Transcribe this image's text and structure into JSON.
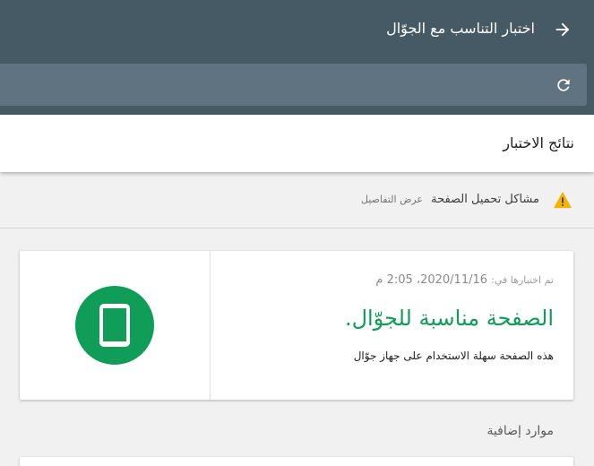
{
  "header": {
    "title": "اختبار التناسب مع الجوّال",
    "back_icon": "arrow-right-icon",
    "url_value": "",
    "refresh_icon": "refresh-icon",
    "background_color": "#455a64",
    "url_bar_color": "#5f7480"
  },
  "results": {
    "title": "نتائج الاختبار"
  },
  "issues": {
    "icon": "warning-icon",
    "icon_color": "#f4b400",
    "label": "مشاكل تحميل الصفحة",
    "link": "عرض التفاصيل"
  },
  "result_card": {
    "tested_prefix": "تم اختبارها في:",
    "tested_date": "2020/11/16",
    "tested_time": "، 2:05 م",
    "headline": "الصفحة مناسبة للجوّال.",
    "description": "هذه الصفحة سهلة الاستخدام على جهاز جوّال",
    "badge_icon": "mobile-phone-icon",
    "accent_color": "#0f9d58"
  },
  "resources": {
    "heading": "موارد إضافية"
  }
}
